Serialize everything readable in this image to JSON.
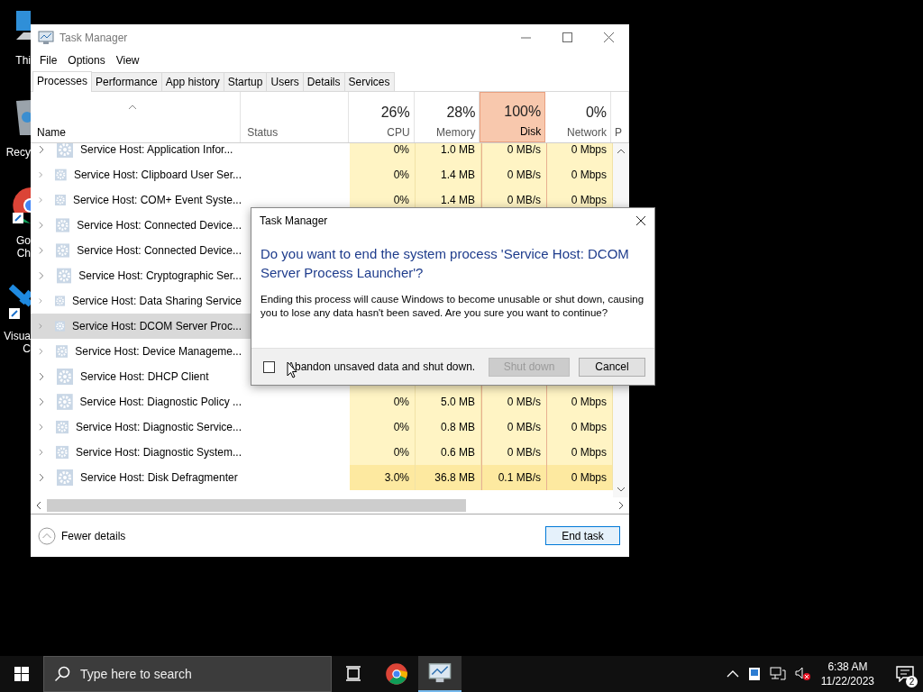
{
  "desktop_icons": [
    {
      "kind": "pc",
      "label": [
        "Thi"
      ]
    },
    {
      "kind": "bin",
      "label": [
        "Recy"
      ]
    },
    {
      "kind": "chrome",
      "label": [
        "Go",
        "Ch"
      ]
    },
    {
      "kind": "code",
      "label": [
        "Visua",
        "C"
      ]
    }
  ],
  "window": {
    "title": "Task Manager"
  },
  "menu": [
    "File",
    "Options",
    "View"
  ],
  "tabs": [
    {
      "label": "Processes",
      "selected": true
    },
    {
      "label": "Performance",
      "selected": false
    },
    {
      "label": "App history",
      "selected": false
    },
    {
      "label": "Startup",
      "selected": false
    },
    {
      "label": "Users",
      "selected": false
    },
    {
      "label": "Details",
      "selected": false
    },
    {
      "label": "Services",
      "selected": false
    }
  ],
  "columns": [
    {
      "label": "Name",
      "sorted": true
    },
    {
      "label": "Status"
    },
    {
      "percent": "26%",
      "label": "CPU",
      "highlighted": false
    },
    {
      "percent": "28%",
      "label": "Memory",
      "highlighted": false
    },
    {
      "percent": "100%",
      "label": "Disk",
      "highlighted": true
    },
    {
      "percent": "0%",
      "label": "Network",
      "highlighted": false
    },
    {
      "label": "P"
    }
  ],
  "rows": [
    {
      "name": "Service Host: Application Infor...",
      "selected": false,
      "active": false,
      "cpu": "0%",
      "memory": "1.0 MB",
      "disk": "0 MB/s",
      "network": "0 Mbps"
    },
    {
      "name": "Service Host: Clipboard User Ser...",
      "selected": false,
      "active": false,
      "cpu": "0%",
      "memory": "1.4 MB",
      "disk": "0 MB/s",
      "network": "0 Mbps"
    },
    {
      "name": "Service Host: COM+ Event Syste...",
      "selected": false,
      "active": false,
      "cpu": "0%",
      "memory": "1.4 MB",
      "disk": "0 MB/s",
      "network": "0 Mbps"
    },
    {
      "name": "Service Host: Connected Device...",
      "selected": false
    },
    {
      "name": "Service Host: Connected Device...",
      "selected": false
    },
    {
      "name": "Service Host: Cryptographic Ser...",
      "selected": false
    },
    {
      "name": "Service Host: Data Sharing Service",
      "selected": false
    },
    {
      "name": "Service Host: DCOM Server Proc...",
      "selected": true
    },
    {
      "name": "Service Host: Device Manageme...",
      "selected": false
    },
    {
      "name": "Service Host: DHCP Client",
      "selected": false
    },
    {
      "name": "Service Host: Diagnostic Policy ...",
      "selected": false,
      "active": false,
      "cpu": "0%",
      "memory": "5.0 MB",
      "disk": "0 MB/s",
      "network": "0 Mbps"
    },
    {
      "name": "Service Host: Diagnostic Service...",
      "selected": false,
      "active": false,
      "cpu": "0%",
      "memory": "0.8 MB",
      "disk": "0 MB/s",
      "network": "0 Mbps"
    },
    {
      "name": "Service Host: Diagnostic System...",
      "selected": false,
      "active": false,
      "cpu": "0%",
      "memory": "0.6 MB",
      "disk": "0 MB/s",
      "network": "0 Mbps"
    },
    {
      "name": "Service Host: Disk Defragmenter",
      "selected": false,
      "active": true,
      "cpu": "3.0%",
      "memory": "36.8 MB",
      "disk": "0.1 MB/s",
      "network": "0 Mbps"
    }
  ],
  "footer": {
    "toggle": "Fewer details",
    "button": "End task"
  },
  "dialog": {
    "title": "Task Manager",
    "heading": "Do you want to end the system process 'Service Host: DCOM Server Process Launcher'?",
    "message": "Ending this process will cause Windows to become unusable or shut down, causing you to lose any data hasn't been saved. Are you sure you want to continue?",
    "checkbox": {
      "label": "Abandon unsaved data and shut down.",
      "checked": false
    },
    "buttons": [
      {
        "label": "Shut down",
        "disabled": true
      },
      {
        "label": "Cancel",
        "disabled": false
      }
    ]
  },
  "taskbar": {
    "search_placeholder": "Type here to search",
    "apps": [
      {
        "kind": "chrome",
        "active": false
      },
      {
        "kind": "taskmgr",
        "active": true
      }
    ],
    "time": "6:38 AM",
    "date": "11/22/2023",
    "notifications": "2"
  }
}
